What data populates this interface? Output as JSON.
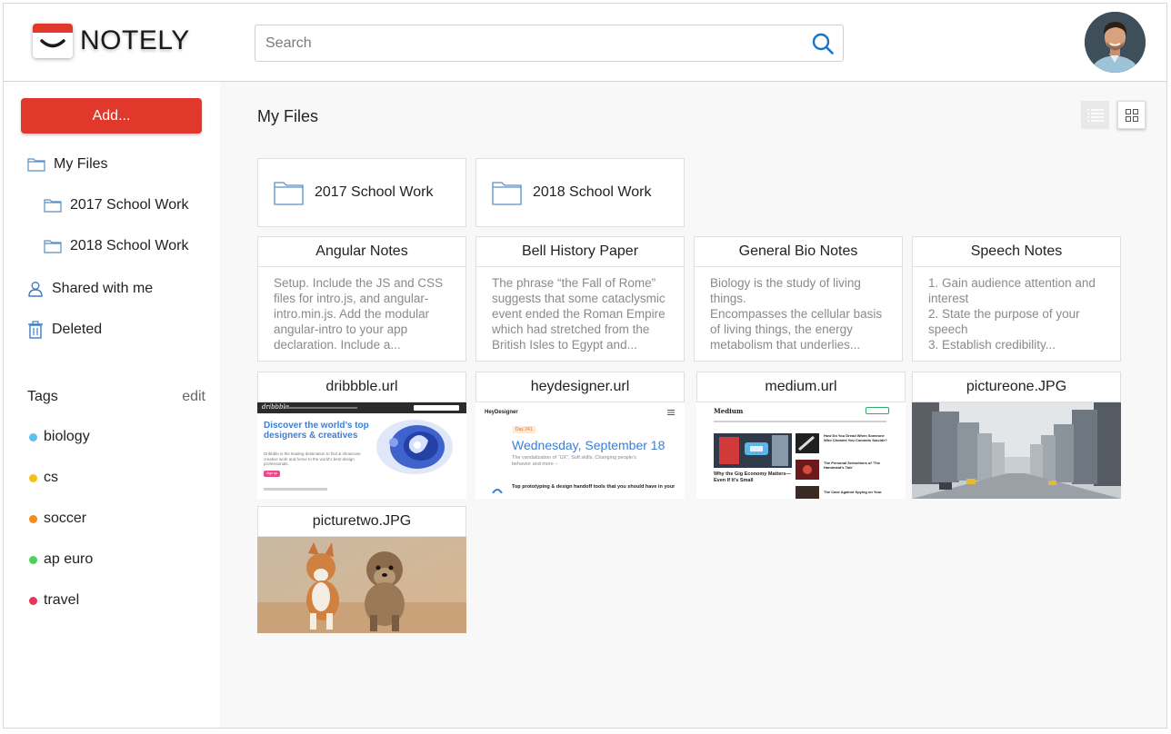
{
  "app": {
    "brand": "NOTELY",
    "brand_color": "#e0382a"
  },
  "header": {
    "search_placeholder": "Search",
    "search_icon": "search-icon",
    "avatar": "user-avatar"
  },
  "sidebar": {
    "add_label": "Add...",
    "nav": [
      {
        "label": "My Files",
        "icon": "folder-icon"
      },
      {
        "label": "2017 School Work",
        "icon": "folder-icon"
      },
      {
        "label": "2018 School Work",
        "icon": "folder-icon"
      },
      {
        "label": "Shared with me",
        "icon": "person-icon"
      },
      {
        "label": "Deleted",
        "icon": "trash-icon"
      }
    ],
    "tags_label": "Tags",
    "tags_edit": "edit",
    "tags": [
      {
        "label": "biology",
        "color": "#5bc0f0"
      },
      {
        "label": "cs",
        "color": "#f2c21b"
      },
      {
        "label": "soccer",
        "color": "#f28a1e"
      },
      {
        "label": "ap euro",
        "color": "#4cd15a"
      },
      {
        "label": "travel",
        "color": "#e8335a"
      }
    ]
  },
  "main": {
    "title": "My Files",
    "folders": [
      {
        "label": "2017 School Work"
      },
      {
        "label": "2018 School Work"
      }
    ],
    "notes": [
      {
        "title": "Angular Notes",
        "lines": [
          "Setup. Include the JS and CSS files for intro.js, and angular-intro.min.js. Add the modular angular-intro to your app declaration. Include a..."
        ]
      },
      {
        "title": "Bell History Paper",
        "lines": [
          "The phrase “the Fall of Rome” suggests that some cataclysmic event ended the Roman Empire which had stretched from the British Isles to Egypt and..."
        ]
      },
      {
        "title": "General Bio Notes",
        "lines": [
          "Biology is the study of living things.",
          "Encompasses the cellular basis of living things, the energy metabolism that underlies..."
        ]
      },
      {
        "title": "Speech Notes",
        "lines": [
          "1. Gain audience attention and interest",
          "2. State the purpose of your speech",
          "3. Establish credibility..."
        ]
      }
    ],
    "files": [
      {
        "title": "dribbble.url",
        "preview": {
          "headline": "Discover the world’s top designers & creatives",
          "subtext": "Dribbble is the leading destination to find & showcase creative work and home to the world’s best design professionals.",
          "button": "Sign up",
          "logo": "dribbble"
        }
      },
      {
        "title": "heydesigner.url",
        "preview": {
          "logo": "HeyDesigner",
          "tag": "Day 241",
          "date": "Wednesday, September 18",
          "subtext": "The vandalization of “UX”, Soft skills, Changing people’s behavior and more –",
          "headline": "Top prototyping & design handoff tools that you should have in your"
        }
      },
      {
        "title": "medium.url",
        "preview": {
          "logo": "Medium",
          "headline": "Why the Gig Economy Matters—Even If It’s Small",
          "side1": "How Do You Dread When Someone Who Cheated You Commits Suicide?",
          "side2": "The Personal Seductions of ‘The Handmaid’s Tale’",
          "side3": "The Case Against Spying on Your"
        }
      },
      {
        "title": "pictureone.JPG"
      },
      {
        "title": "picturetwo.JPG"
      }
    ]
  }
}
